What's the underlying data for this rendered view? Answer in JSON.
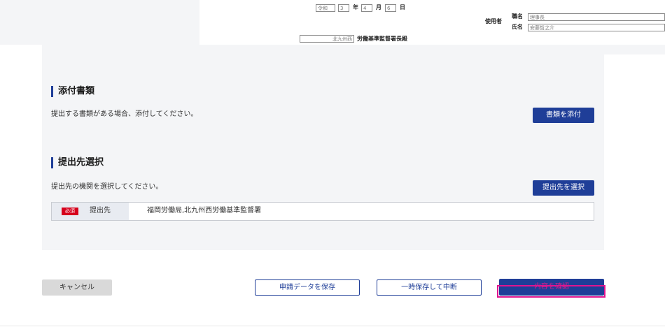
{
  "form_preview": {
    "era": "令和",
    "year": "3",
    "year_unit": "年",
    "month": "4",
    "month_unit": "月",
    "day": "6",
    "day_unit": "日",
    "employer_label": "使用者",
    "position_label": "職名",
    "position_value": "理事長",
    "name_label": "氏名",
    "name_value": "安藤哲之介",
    "office_name": "北九州西",
    "office_suffix": "労働基準監督署長殿"
  },
  "attachments": {
    "title": "添付書類",
    "description": "提出する書類がある場合、添付してください。",
    "button_label": "書類を添付"
  },
  "destination": {
    "title": "提出先選択",
    "description": "提出先の機関を選択してください。",
    "button_label": "提出先を選択",
    "required_badge": "必須",
    "field_label": "提出先",
    "field_value": "福岡労働局,北九州西労働基準監督署"
  },
  "actions": {
    "cancel_label": "キャンセル",
    "save_label": "申請データを保存",
    "suspend_label": "一時保存して中断",
    "confirm_label": "内容を確認"
  },
  "colors": {
    "primary": "#1f3e98",
    "required": "#d6001c",
    "highlight": "#e0158f",
    "panel_bg": "#f4f5f7"
  }
}
